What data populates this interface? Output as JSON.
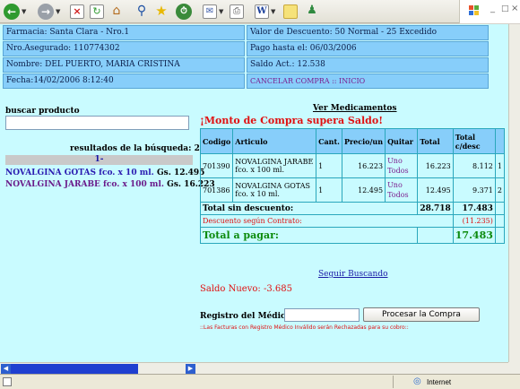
{
  "toolbar": {
    "buttons": [
      "back",
      "forward",
      "stop",
      "refresh",
      "home",
      "search",
      "favorites",
      "history",
      "mail",
      "print",
      "edit",
      "folder",
      "messenger"
    ]
  },
  "header": {
    "farmacia": "Farmacia: Santa Clara - Nro.1",
    "valor_descuento": "Valor de Descuento: 50 Normal - 25 Excedido",
    "nro_asegurado": "Nro.Asegurado: 110774302",
    "pago_hasta": "Pago hasta el: 06/03/2006",
    "nombre": "Nombre: DEL PUERTO, MARIA CRISTINA",
    "saldo_act": "Saldo Act.: 12.538",
    "fecha": "Fecha:14/02/2006 8:12:40",
    "cancelar": "CANCELAR COMPRA :: INICIO"
  },
  "search": {
    "label": "buscar producto",
    "value": "",
    "results_label": "resultados de la búsqueda: 2",
    "page": "1-",
    "products": [
      {
        "name": "NOVALGINA GOTAS fco. x 10 ml.",
        "price": "Gs. 12.495"
      },
      {
        "name": "NOVALGINA JARABE fco. x 100 ml.",
        "price": "Gs. 16.223"
      }
    ]
  },
  "cart": {
    "title": "Ver Medicamentos",
    "warning": "¡Monto de Compra supera Saldo!",
    "headers": [
      "Codigo",
      "Articulo",
      "Cant.",
      "Precio/un",
      "Quitar",
      "Total",
      "Total c/desc"
    ],
    "rows": [
      {
        "codigo": "701390",
        "articulo": "NOVALGINA JARABE fco. x 100 ml.",
        "cant": "1",
        "precio": "16.223",
        "quitar_uno": "Uno",
        "quitar_todos": "Todos",
        "total": "16.223",
        "total_desc": "8.112",
        "idx": "1"
      },
      {
        "codigo": "701386",
        "articulo": "NOVALGINA GOTAS fco. x 10 ml.",
        "cant": "1",
        "precio": "12.495",
        "quitar_uno": "Uno",
        "quitar_todos": "Todos",
        "total": "12.495",
        "total_desc": "9.371",
        "idx": "2"
      }
    ],
    "total_sin_desc_label": "Total sin descuento:",
    "total_sin_desc": "28.718",
    "total_sin_desc2": "17.483",
    "descuento_label": "Descuento según Contrato:",
    "descuento": "(11.235)",
    "total_pagar_label": "Total a pagar:",
    "total_pagar": "17.483"
  },
  "seguir": "Seguir Buscando",
  "saldo_nuevo": "Saldo Nuevo: -3.685",
  "registro": {
    "label": "Registro del Médico",
    "value": "",
    "button": "Procesar la Compra",
    "note": "::Las Facturas con Registro Médico Inválido serán Rechazadas para su cobro::"
  },
  "status": {
    "zone": "Internet"
  }
}
